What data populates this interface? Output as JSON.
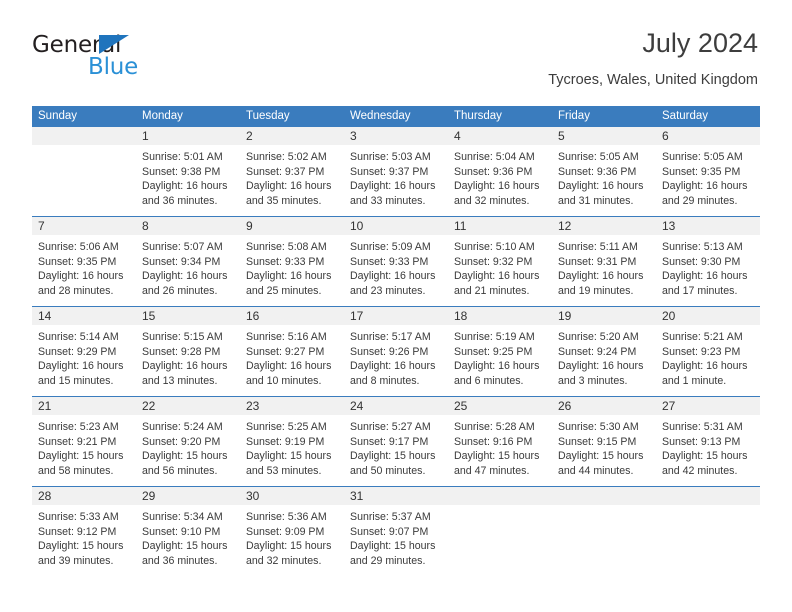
{
  "brand": {
    "name_dark": "General",
    "name_blue": "Blue",
    "accent_blue": "#2a90d6",
    "triangle_blue": "#1f74bd"
  },
  "header": {
    "title": "July 2024",
    "subtitle": "Tycroes, Wales, United Kingdom"
  },
  "calendar": {
    "header_bg": "#3a7cbe",
    "daynum_bg": "#f1f1f1",
    "weekdays": [
      "Sunday",
      "Monday",
      "Tuesday",
      "Wednesday",
      "Thursday",
      "Friday",
      "Saturday"
    ],
    "weeks": [
      [
        {
          "day": "",
          "lines": []
        },
        {
          "day": "1",
          "lines": [
            "Sunrise: 5:01 AM",
            "Sunset: 9:38 PM",
            "Daylight: 16 hours",
            "and 36 minutes."
          ]
        },
        {
          "day": "2",
          "lines": [
            "Sunrise: 5:02 AM",
            "Sunset: 9:37 PM",
            "Daylight: 16 hours",
            "and 35 minutes."
          ]
        },
        {
          "day": "3",
          "lines": [
            "Sunrise: 5:03 AM",
            "Sunset: 9:37 PM",
            "Daylight: 16 hours",
            "and 33 minutes."
          ]
        },
        {
          "day": "4",
          "lines": [
            "Sunrise: 5:04 AM",
            "Sunset: 9:36 PM",
            "Daylight: 16 hours",
            "and 32 minutes."
          ]
        },
        {
          "day": "5",
          "lines": [
            "Sunrise: 5:05 AM",
            "Sunset: 9:36 PM",
            "Daylight: 16 hours",
            "and 31 minutes."
          ]
        },
        {
          "day": "6",
          "lines": [
            "Sunrise: 5:05 AM",
            "Sunset: 9:35 PM",
            "Daylight: 16 hours",
            "and 29 minutes."
          ]
        }
      ],
      [
        {
          "day": "7",
          "lines": [
            "Sunrise: 5:06 AM",
            "Sunset: 9:35 PM",
            "Daylight: 16 hours",
            "and 28 minutes."
          ]
        },
        {
          "day": "8",
          "lines": [
            "Sunrise: 5:07 AM",
            "Sunset: 9:34 PM",
            "Daylight: 16 hours",
            "and 26 minutes."
          ]
        },
        {
          "day": "9",
          "lines": [
            "Sunrise: 5:08 AM",
            "Sunset: 9:33 PM",
            "Daylight: 16 hours",
            "and 25 minutes."
          ]
        },
        {
          "day": "10",
          "lines": [
            "Sunrise: 5:09 AM",
            "Sunset: 9:33 PM",
            "Daylight: 16 hours",
            "and 23 minutes."
          ]
        },
        {
          "day": "11",
          "lines": [
            "Sunrise: 5:10 AM",
            "Sunset: 9:32 PM",
            "Daylight: 16 hours",
            "and 21 minutes."
          ]
        },
        {
          "day": "12",
          "lines": [
            "Sunrise: 5:11 AM",
            "Sunset: 9:31 PM",
            "Daylight: 16 hours",
            "and 19 minutes."
          ]
        },
        {
          "day": "13",
          "lines": [
            "Sunrise: 5:13 AM",
            "Sunset: 9:30 PM",
            "Daylight: 16 hours",
            "and 17 minutes."
          ]
        }
      ],
      [
        {
          "day": "14",
          "lines": [
            "Sunrise: 5:14 AM",
            "Sunset: 9:29 PM",
            "Daylight: 16 hours",
            "and 15 minutes."
          ]
        },
        {
          "day": "15",
          "lines": [
            "Sunrise: 5:15 AM",
            "Sunset: 9:28 PM",
            "Daylight: 16 hours",
            "and 13 minutes."
          ]
        },
        {
          "day": "16",
          "lines": [
            "Sunrise: 5:16 AM",
            "Sunset: 9:27 PM",
            "Daylight: 16 hours",
            "and 10 minutes."
          ]
        },
        {
          "day": "17",
          "lines": [
            "Sunrise: 5:17 AM",
            "Sunset: 9:26 PM",
            "Daylight: 16 hours",
            "and 8 minutes."
          ]
        },
        {
          "day": "18",
          "lines": [
            "Sunrise: 5:19 AM",
            "Sunset: 9:25 PM",
            "Daylight: 16 hours",
            "and 6 minutes."
          ]
        },
        {
          "day": "19",
          "lines": [
            "Sunrise: 5:20 AM",
            "Sunset: 9:24 PM",
            "Daylight: 16 hours",
            "and 3 minutes."
          ]
        },
        {
          "day": "20",
          "lines": [
            "Sunrise: 5:21 AM",
            "Sunset: 9:23 PM",
            "Daylight: 16 hours",
            "and 1 minute."
          ]
        }
      ],
      [
        {
          "day": "21",
          "lines": [
            "Sunrise: 5:23 AM",
            "Sunset: 9:21 PM",
            "Daylight: 15 hours",
            "and 58 minutes."
          ]
        },
        {
          "day": "22",
          "lines": [
            "Sunrise: 5:24 AM",
            "Sunset: 9:20 PM",
            "Daylight: 15 hours",
            "and 56 minutes."
          ]
        },
        {
          "day": "23",
          "lines": [
            "Sunrise: 5:25 AM",
            "Sunset: 9:19 PM",
            "Daylight: 15 hours",
            "and 53 minutes."
          ]
        },
        {
          "day": "24",
          "lines": [
            "Sunrise: 5:27 AM",
            "Sunset: 9:17 PM",
            "Daylight: 15 hours",
            "and 50 minutes."
          ]
        },
        {
          "day": "25",
          "lines": [
            "Sunrise: 5:28 AM",
            "Sunset: 9:16 PM",
            "Daylight: 15 hours",
            "and 47 minutes."
          ]
        },
        {
          "day": "26",
          "lines": [
            "Sunrise: 5:30 AM",
            "Sunset: 9:15 PM",
            "Daylight: 15 hours",
            "and 44 minutes."
          ]
        },
        {
          "day": "27",
          "lines": [
            "Sunrise: 5:31 AM",
            "Sunset: 9:13 PM",
            "Daylight: 15 hours",
            "and 42 minutes."
          ]
        }
      ],
      [
        {
          "day": "28",
          "lines": [
            "Sunrise: 5:33 AM",
            "Sunset: 9:12 PM",
            "Daylight: 15 hours",
            "and 39 minutes."
          ]
        },
        {
          "day": "29",
          "lines": [
            "Sunrise: 5:34 AM",
            "Sunset: 9:10 PM",
            "Daylight: 15 hours",
            "and 36 minutes."
          ]
        },
        {
          "day": "30",
          "lines": [
            "Sunrise: 5:36 AM",
            "Sunset: 9:09 PM",
            "Daylight: 15 hours",
            "and 32 minutes."
          ]
        },
        {
          "day": "31",
          "lines": [
            "Sunrise: 5:37 AM",
            "Sunset: 9:07 PM",
            "Daylight: 15 hours",
            "and 29 minutes."
          ]
        },
        {
          "day": "",
          "lines": []
        },
        {
          "day": "",
          "lines": []
        },
        {
          "day": "",
          "lines": []
        }
      ]
    ]
  }
}
